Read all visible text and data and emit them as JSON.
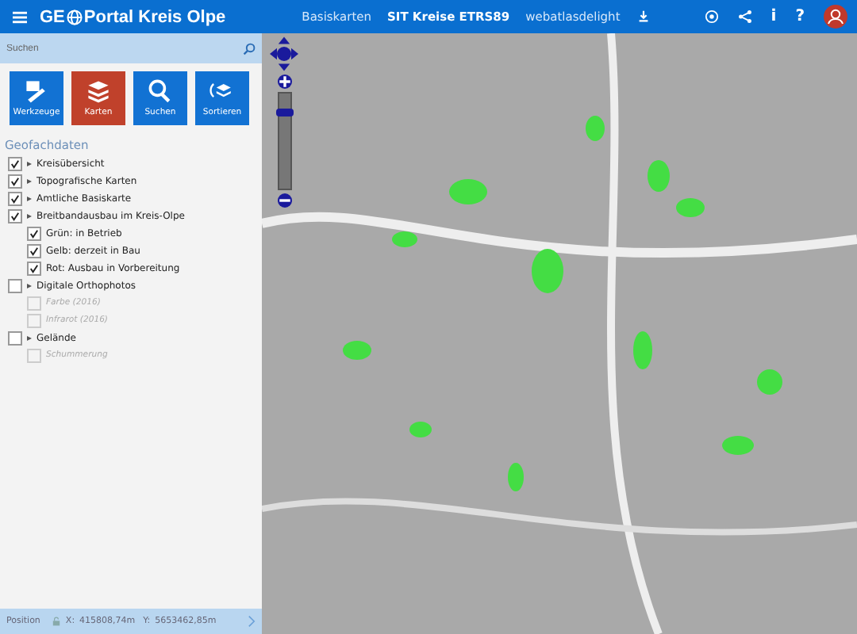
{
  "header": {
    "logo_start": "GE",
    "logo_end": "Portal Kreis Olpe",
    "nav": [
      {
        "label": "Basiskarten",
        "selected": false
      },
      {
        "label": "SIT Kreise ETRS89",
        "selected": true
      },
      {
        "label": "webatlasdelight",
        "selected": false
      }
    ],
    "info_glyph": "i",
    "help_glyph": "?"
  },
  "search": {
    "placeholder": "Suchen"
  },
  "tools": [
    {
      "label": "Werkzeuge",
      "kind": "tools",
      "selected": false
    },
    {
      "label": "Karten",
      "kind": "layers",
      "selected": true
    },
    {
      "label": "Suchen",
      "kind": "search",
      "selected": false
    },
    {
      "label": "Sortieren",
      "kind": "sort",
      "selected": false
    }
  ],
  "layers": {
    "title": "Geofachdaten",
    "items": [
      {
        "label": "Kreisübersicht",
        "checked": true,
        "disabled": false
      },
      {
        "label": "Topografische Karten",
        "checked": true,
        "disabled": false
      },
      {
        "label": "Amtliche Basiskarte",
        "checked": true,
        "disabled": false
      },
      {
        "label": "Breitbandausbau im Kreis-Olpe",
        "checked": true,
        "disabled": false,
        "children": [
          {
            "label": "Grün: in Betrieb",
            "checked": true,
            "disabled": false
          },
          {
            "label": "Gelb: derzeit in Bau",
            "checked": true,
            "disabled": false
          },
          {
            "label": "Rot: Ausbau in Vorbereitung",
            "checked": true,
            "disabled": false
          }
        ]
      },
      {
        "label": "Digitale Orthophotos",
        "checked": false,
        "disabled": false,
        "children": [
          {
            "label": "Farbe (2016)",
            "checked": false,
            "disabled": true
          },
          {
            "label": "Infrarot (2016)",
            "checked": false,
            "disabled": true
          }
        ]
      },
      {
        "label": "Gelände",
        "checked": false,
        "disabled": false,
        "children": [
          {
            "label": "Schummerung",
            "checked": false,
            "disabled": true
          }
        ]
      }
    ]
  },
  "zoom": {
    "level": 0.8
  },
  "position": {
    "label": "Position",
    "x_label": "X:",
    "x": "415808,74m",
    "y_label": "Y:",
    "y": "5653462,85m"
  }
}
